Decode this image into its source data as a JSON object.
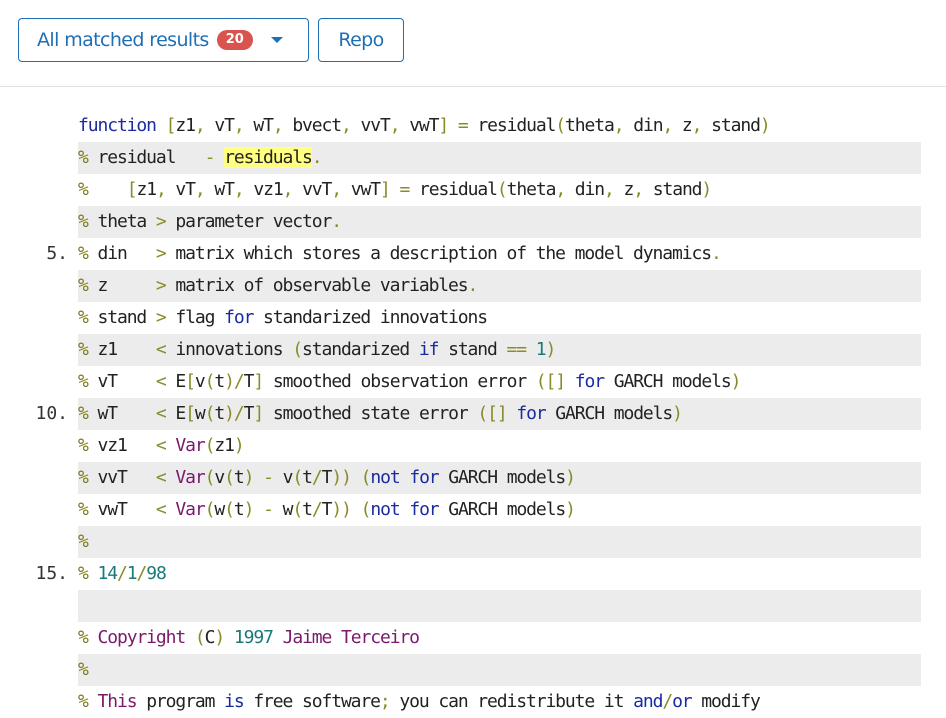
{
  "toolbar": {
    "results_button": {
      "label": "All matched results",
      "count": "20"
    },
    "repo_button": {
      "label": "Repo"
    }
  },
  "code": {
    "lines": [
      {
        "number": "",
        "tokens": [
          [
            "kw",
            "function"
          ],
          [
            "plain",
            " "
          ],
          [
            "punc",
            "["
          ],
          [
            "plain",
            "z1"
          ],
          [
            "punc",
            ","
          ],
          [
            "plain",
            " vT"
          ],
          [
            "punc",
            ","
          ],
          [
            "plain",
            " wT"
          ],
          [
            "punc",
            ","
          ],
          [
            "plain",
            " bvect"
          ],
          [
            "punc",
            ","
          ],
          [
            "plain",
            " vvT"
          ],
          [
            "punc",
            ","
          ],
          [
            "plain",
            " vwT"
          ],
          [
            "punc",
            "]"
          ],
          [
            "plain",
            " "
          ],
          [
            "punc",
            "="
          ],
          [
            "plain",
            " residual"
          ],
          [
            "punc",
            "("
          ],
          [
            "plain",
            "theta"
          ],
          [
            "punc",
            ","
          ],
          [
            "plain",
            " din"
          ],
          [
            "punc",
            ","
          ],
          [
            "plain",
            " z"
          ],
          [
            "punc",
            ","
          ],
          [
            "plain",
            " stand"
          ],
          [
            "punc",
            ")"
          ]
        ]
      },
      {
        "number": "",
        "tokens": [
          [
            "pct",
            "%"
          ],
          [
            "plain",
            " residual   "
          ],
          [
            "punc",
            "-"
          ],
          [
            "plain",
            " "
          ],
          [
            "hl",
            "residuals"
          ],
          [
            "punc",
            "."
          ]
        ]
      },
      {
        "number": "",
        "tokens": [
          [
            "pct",
            "%"
          ],
          [
            "plain",
            "    "
          ],
          [
            "punc",
            "["
          ],
          [
            "plain",
            "z1"
          ],
          [
            "punc",
            ","
          ],
          [
            "plain",
            " vT"
          ],
          [
            "punc",
            ","
          ],
          [
            "plain",
            " wT"
          ],
          [
            "punc",
            ","
          ],
          [
            "plain",
            " vz1"
          ],
          [
            "punc",
            ","
          ],
          [
            "plain",
            " vvT"
          ],
          [
            "punc",
            ","
          ],
          [
            "plain",
            " vwT"
          ],
          [
            "punc",
            "]"
          ],
          [
            "plain",
            " "
          ],
          [
            "punc",
            "="
          ],
          [
            "plain",
            " residual"
          ],
          [
            "punc",
            "("
          ],
          [
            "plain",
            "theta"
          ],
          [
            "punc",
            ","
          ],
          [
            "plain",
            " din"
          ],
          [
            "punc",
            ","
          ],
          [
            "plain",
            " z"
          ],
          [
            "punc",
            ","
          ],
          [
            "plain",
            " stand"
          ],
          [
            "punc",
            ")"
          ]
        ]
      },
      {
        "number": "",
        "tokens": [
          [
            "pct",
            "%"
          ],
          [
            "plain",
            " theta "
          ],
          [
            "punc",
            ">"
          ],
          [
            "plain",
            " parameter vector"
          ],
          [
            "punc",
            "."
          ]
        ]
      },
      {
        "number": "5.",
        "tokens": [
          [
            "pct",
            "%"
          ],
          [
            "plain",
            " din   "
          ],
          [
            "punc",
            ">"
          ],
          [
            "plain",
            " matrix which stores a description of the model dynamics"
          ],
          [
            "punc",
            "."
          ]
        ]
      },
      {
        "number": "",
        "tokens": [
          [
            "pct",
            "%"
          ],
          [
            "plain",
            " z     "
          ],
          [
            "punc",
            ">"
          ],
          [
            "plain",
            " matrix of observable variables"
          ],
          [
            "punc",
            "."
          ]
        ]
      },
      {
        "number": "",
        "tokens": [
          [
            "pct",
            "%"
          ],
          [
            "plain",
            " stand "
          ],
          [
            "punc",
            ">"
          ],
          [
            "plain",
            " flag "
          ],
          [
            "kw",
            "for"
          ],
          [
            "plain",
            " standarized innovations"
          ]
        ]
      },
      {
        "number": "",
        "tokens": [
          [
            "pct",
            "%"
          ],
          [
            "plain",
            " z1    "
          ],
          [
            "punc",
            "<"
          ],
          [
            "plain",
            " innovations "
          ],
          [
            "punc",
            "("
          ],
          [
            "plain",
            "standarized "
          ],
          [
            "kw",
            "if"
          ],
          [
            "plain",
            " stand "
          ],
          [
            "punc",
            "=="
          ],
          [
            "plain",
            " "
          ],
          [
            "num",
            "1"
          ],
          [
            "punc",
            ")"
          ]
        ]
      },
      {
        "number": "",
        "tokens": [
          [
            "pct",
            "%"
          ],
          [
            "plain",
            " vT    "
          ],
          [
            "punc",
            "<"
          ],
          [
            "plain",
            " E"
          ],
          [
            "punc",
            "["
          ],
          [
            "plain",
            "v"
          ],
          [
            "punc",
            "("
          ],
          [
            "plain",
            "t"
          ],
          [
            "punc",
            ")"
          ],
          [
            "punc",
            "/"
          ],
          [
            "plain",
            "T"
          ],
          [
            "punc",
            "]"
          ],
          [
            "plain",
            " smoothed observation error "
          ],
          [
            "punc",
            "([]"
          ],
          [
            "plain",
            " "
          ],
          [
            "kw",
            "for"
          ],
          [
            "plain",
            " GARCH models"
          ],
          [
            "punc",
            ")"
          ]
        ]
      },
      {
        "number": "10.",
        "tokens": [
          [
            "pct",
            "%"
          ],
          [
            "plain",
            " wT    "
          ],
          [
            "punc",
            "<"
          ],
          [
            "plain",
            " E"
          ],
          [
            "punc",
            "["
          ],
          [
            "plain",
            "w"
          ],
          [
            "punc",
            "("
          ],
          [
            "plain",
            "t"
          ],
          [
            "punc",
            ")"
          ],
          [
            "punc",
            "/"
          ],
          [
            "plain",
            "T"
          ],
          [
            "punc",
            "]"
          ],
          [
            "plain",
            " smoothed state error "
          ],
          [
            "punc",
            "([]"
          ],
          [
            "plain",
            " "
          ],
          [
            "kw",
            "for"
          ],
          [
            "plain",
            " GARCH models"
          ],
          [
            "punc",
            ")"
          ]
        ]
      },
      {
        "number": "",
        "tokens": [
          [
            "pct",
            "%"
          ],
          [
            "plain",
            " vz1   "
          ],
          [
            "punc",
            "<"
          ],
          [
            "plain",
            " "
          ],
          [
            "fn",
            "Var"
          ],
          [
            "punc",
            "("
          ],
          [
            "plain",
            "z1"
          ],
          [
            "punc",
            ")"
          ]
        ]
      },
      {
        "number": "",
        "tokens": [
          [
            "pct",
            "%"
          ],
          [
            "plain",
            " vvT   "
          ],
          [
            "punc",
            "<"
          ],
          [
            "plain",
            " "
          ],
          [
            "fn",
            "Var"
          ],
          [
            "punc",
            "("
          ],
          [
            "plain",
            "v"
          ],
          [
            "punc",
            "("
          ],
          [
            "plain",
            "t"
          ],
          [
            "punc",
            ")"
          ],
          [
            "plain",
            " "
          ],
          [
            "punc",
            "-"
          ],
          [
            "plain",
            " v"
          ],
          [
            "punc",
            "("
          ],
          [
            "plain",
            "t"
          ],
          [
            "punc",
            "/"
          ],
          [
            "plain",
            "T"
          ],
          [
            "punc",
            "))"
          ],
          [
            "plain",
            " "
          ],
          [
            "punc",
            "("
          ],
          [
            "kw",
            "not"
          ],
          [
            "plain",
            " "
          ],
          [
            "kw",
            "for"
          ],
          [
            "plain",
            " GARCH models"
          ],
          [
            "punc",
            ")"
          ]
        ]
      },
      {
        "number": "",
        "tokens": [
          [
            "pct",
            "%"
          ],
          [
            "plain",
            " vwT   "
          ],
          [
            "punc",
            "<"
          ],
          [
            "plain",
            " "
          ],
          [
            "fn",
            "Var"
          ],
          [
            "punc",
            "("
          ],
          [
            "plain",
            "w"
          ],
          [
            "punc",
            "("
          ],
          [
            "plain",
            "t"
          ],
          [
            "punc",
            ")"
          ],
          [
            "plain",
            " "
          ],
          [
            "punc",
            "-"
          ],
          [
            "plain",
            " w"
          ],
          [
            "punc",
            "("
          ],
          [
            "plain",
            "t"
          ],
          [
            "punc",
            "/"
          ],
          [
            "plain",
            "T"
          ],
          [
            "punc",
            "))"
          ],
          [
            "plain",
            " "
          ],
          [
            "punc",
            "("
          ],
          [
            "kw",
            "not"
          ],
          [
            "plain",
            " "
          ],
          [
            "kw",
            "for"
          ],
          [
            "plain",
            " GARCH models"
          ],
          [
            "punc",
            ")"
          ]
        ]
      },
      {
        "number": "",
        "tokens": [
          [
            "pct",
            "%"
          ]
        ]
      },
      {
        "number": "15.",
        "tokens": [
          [
            "pct",
            "%"
          ],
          [
            "plain",
            " "
          ],
          [
            "num",
            "14"
          ],
          [
            "punc",
            "/"
          ],
          [
            "num",
            "1"
          ],
          [
            "punc",
            "/"
          ],
          [
            "num",
            "98"
          ]
        ]
      },
      {
        "number": "",
        "tokens": []
      },
      {
        "number": "",
        "tokens": [
          [
            "pct",
            "%"
          ],
          [
            "plain",
            " "
          ],
          [
            "fn",
            "Copyright"
          ],
          [
            "plain",
            " "
          ],
          [
            "punc",
            "("
          ],
          [
            "plain",
            "C"
          ],
          [
            "punc",
            ")"
          ],
          [
            "plain",
            " "
          ],
          [
            "num",
            "1997"
          ],
          [
            "plain",
            " "
          ],
          [
            "fn",
            "Jaime Terceiro"
          ]
        ]
      },
      {
        "number": "",
        "tokens": [
          [
            "pct",
            "%"
          ]
        ]
      },
      {
        "number": "",
        "tokens": [
          [
            "pct",
            "%"
          ],
          [
            "plain",
            " "
          ],
          [
            "fn",
            "This"
          ],
          [
            "plain",
            " program "
          ],
          [
            "kw",
            "is"
          ],
          [
            "plain",
            " free software"
          ],
          [
            "punc",
            ";"
          ],
          [
            "plain",
            " you can redistribute it "
          ],
          [
            "kw",
            "and"
          ],
          [
            "punc",
            "/"
          ],
          [
            "kw",
            "or"
          ],
          [
            "plain",
            " modify"
          ]
        ]
      }
    ]
  }
}
